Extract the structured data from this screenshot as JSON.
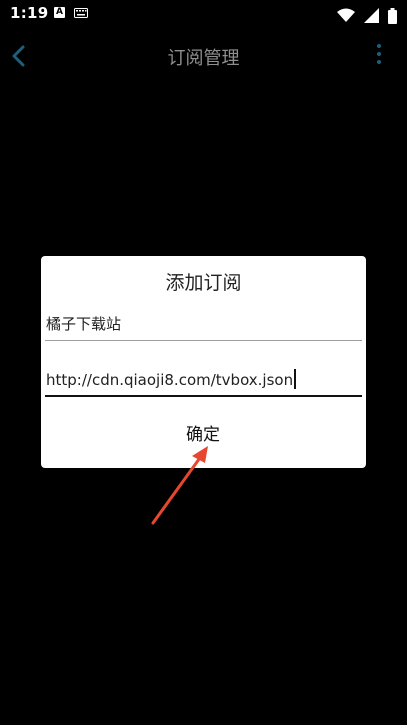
{
  "status_bar": {
    "time": "1:19",
    "notification_badge": "A",
    "icons": [
      "keyboard-icon",
      "wifi-icon",
      "signal-icon",
      "battery-icon"
    ]
  },
  "app_bar": {
    "title": "订阅管理",
    "back_icon": "chevron-left-icon",
    "menu_icon": "more-vertical-icon",
    "accent_color": "#1c5f7a"
  },
  "dialog": {
    "title": "添加订阅",
    "name_field": {
      "value": "橘子下载站"
    },
    "url_field": {
      "value": "http://cdn.qiaoji8.com/tvbox.json"
    },
    "confirm_label": "确定"
  },
  "annotation": {
    "arrow_color": "#e8472f"
  }
}
